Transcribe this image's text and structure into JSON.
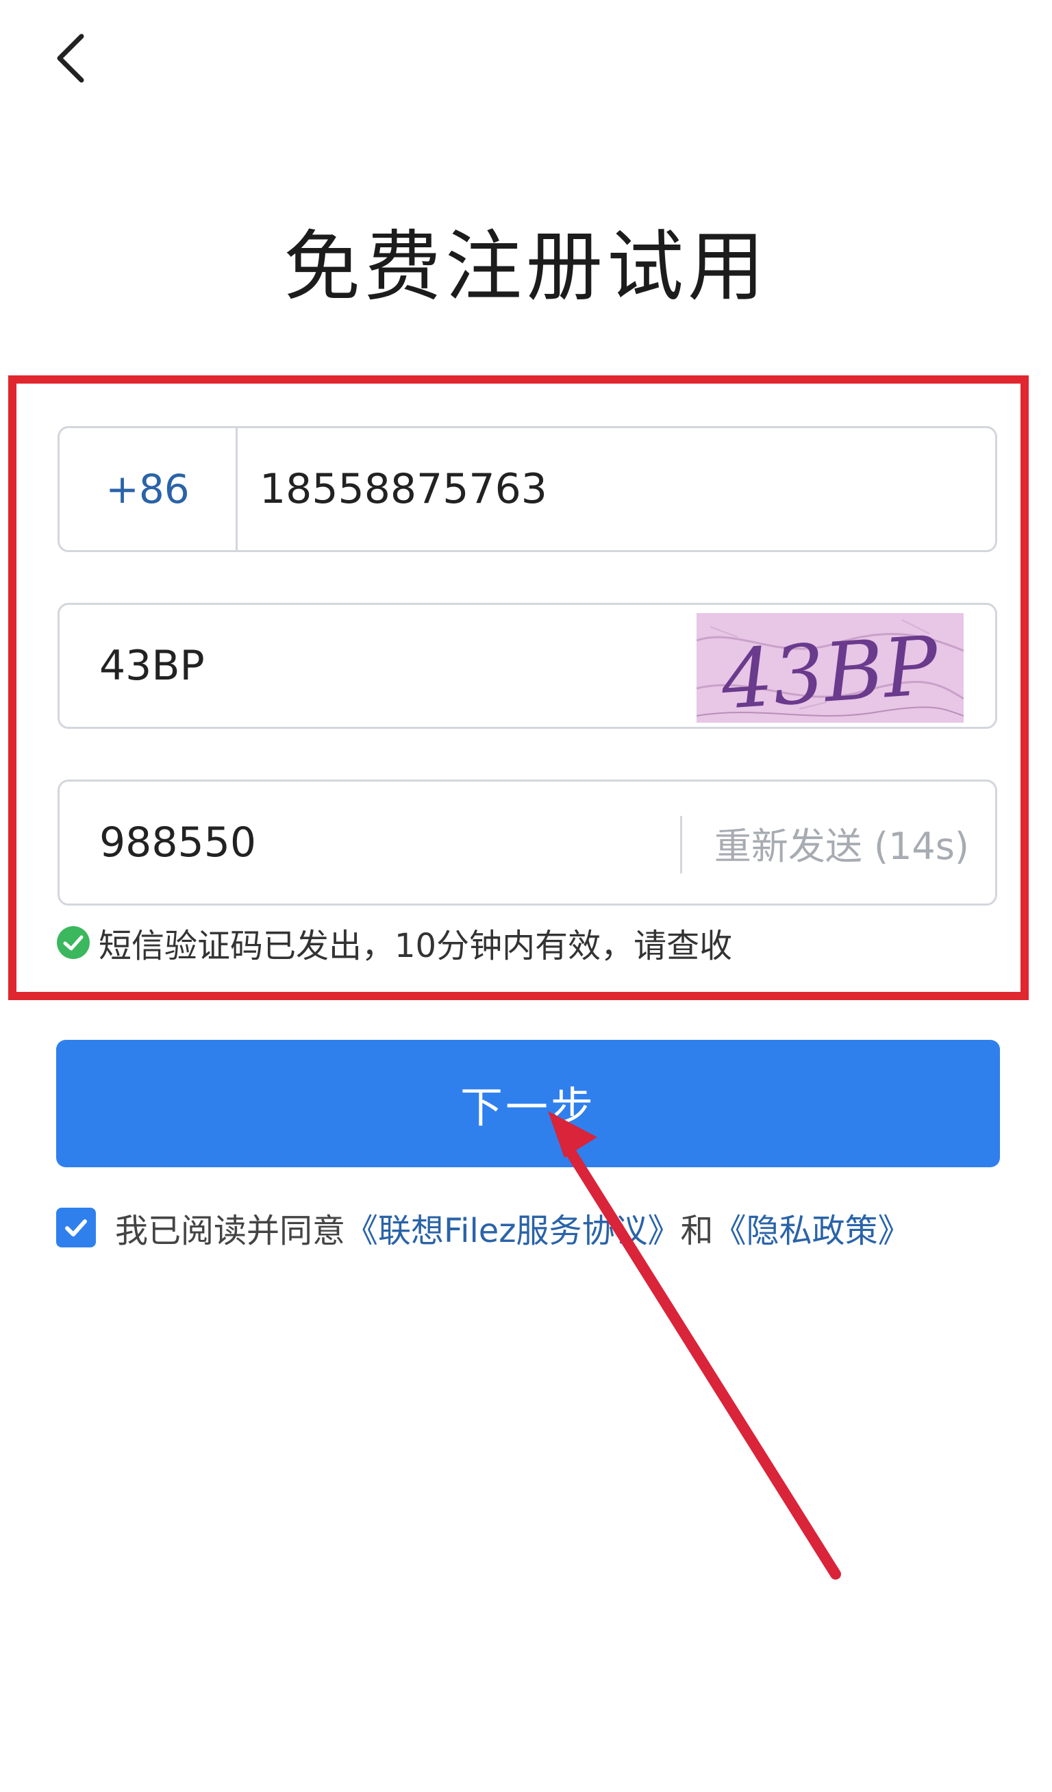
{
  "header": {
    "back_icon": "chevron-left-icon",
    "title": "免费注册试用"
  },
  "form": {
    "phone": {
      "country_code": "+86",
      "value": "18558875763"
    },
    "captcha": {
      "value": "43BP",
      "image_text": "43BP"
    },
    "sms": {
      "value": "988550",
      "resend_label": "重新发送 (14s)"
    },
    "notice": {
      "icon": "check-circle-icon",
      "text": "短信验证码已发出，10分钟内有效，请查收"
    }
  },
  "actions": {
    "next_label": "下一步"
  },
  "agreement": {
    "checked": true,
    "prefix": "我已阅读并同意",
    "terms_link": "《联想Filez服务协议》",
    "conjunction": "和",
    "privacy_link": "《隐私政策》"
  },
  "colors": {
    "primary": "#2f80ed",
    "link": "#2a63a8",
    "highlight": "#e0262f",
    "success": "#3bb75e"
  }
}
